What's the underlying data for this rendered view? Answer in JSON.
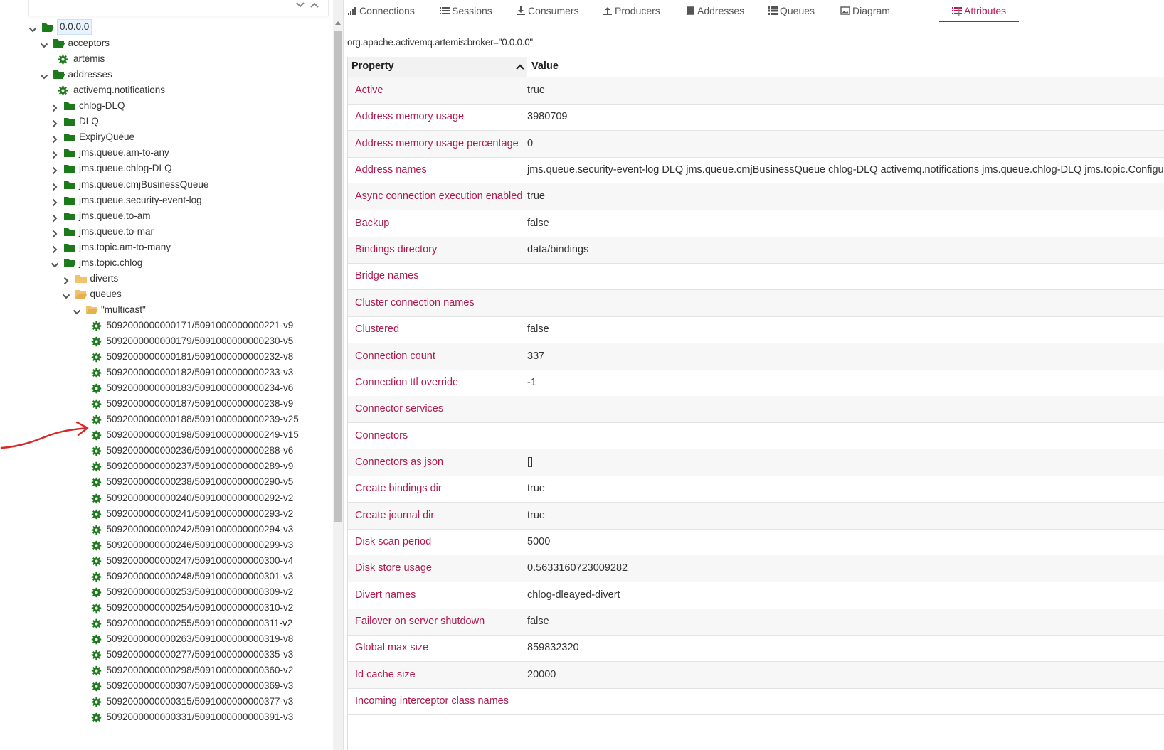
{
  "tree": {
    "nodes": [
      {
        "label": "0.0.0.0",
        "indent": 0,
        "icon": "folder-open-icon",
        "toggle": "expanded",
        "selected": true
      },
      {
        "label": "acceptors",
        "indent": 1,
        "icon": "folder-open-icon",
        "toggle": "expanded"
      },
      {
        "label": "artemis",
        "indent": 2,
        "icon": "gear-icon",
        "toggle": "none"
      },
      {
        "label": "addresses",
        "indent": 1,
        "icon": "folder-open-icon",
        "toggle": "expanded"
      },
      {
        "label": "activemq.notifications",
        "indent": 2,
        "icon": "gear-icon",
        "toggle": "none"
      },
      {
        "label": "chlog-DLQ",
        "indent": 2,
        "icon": "folder-icon",
        "toggle": "collapsed"
      },
      {
        "label": "DLQ",
        "indent": 2,
        "icon": "folder-icon",
        "toggle": "collapsed"
      },
      {
        "label": "ExpiryQueue",
        "indent": 2,
        "icon": "folder-icon",
        "toggle": "collapsed"
      },
      {
        "label": "jms.queue.am-to-any",
        "indent": 2,
        "icon": "folder-icon",
        "toggle": "collapsed"
      },
      {
        "label": "jms.queue.chlog-DLQ",
        "indent": 2,
        "icon": "folder-icon",
        "toggle": "collapsed"
      },
      {
        "label": "jms.queue.cmjBusinessQueue",
        "indent": 2,
        "icon": "folder-icon",
        "toggle": "collapsed"
      },
      {
        "label": "jms.queue.security-event-log",
        "indent": 2,
        "icon": "folder-icon",
        "toggle": "collapsed"
      },
      {
        "label": "jms.queue.to-am",
        "indent": 2,
        "icon": "folder-icon",
        "toggle": "collapsed"
      },
      {
        "label": "jms.queue.to-mar",
        "indent": 2,
        "icon": "folder-icon",
        "toggle": "collapsed"
      },
      {
        "label": "jms.topic.am-to-many",
        "indent": 2,
        "icon": "folder-icon",
        "toggle": "collapsed"
      },
      {
        "label": "jms.topic.chlog",
        "indent": 2,
        "icon": "folder-open-icon",
        "toggle": "expanded"
      },
      {
        "label": "diverts",
        "indent": 3,
        "icon": "folder-plain-icon",
        "toggle": "collapsed"
      },
      {
        "label": "queues",
        "indent": 3,
        "icon": "folder-open-plain-icon",
        "toggle": "expanded"
      },
      {
        "label": "\"multicast\"",
        "indent": 4,
        "icon": "folder-open-plain-icon",
        "toggle": "expanded"
      },
      {
        "label": "5092000000000171/5091000000000221-v9",
        "indent": 5,
        "icon": "gear-icon",
        "toggle": "none"
      },
      {
        "label": "5092000000000179/5091000000000230-v5",
        "indent": 5,
        "icon": "gear-icon",
        "toggle": "none"
      },
      {
        "label": "5092000000000181/5091000000000232-v8",
        "indent": 5,
        "icon": "gear-icon",
        "toggle": "none"
      },
      {
        "label": "5092000000000182/5091000000000233-v3",
        "indent": 5,
        "icon": "gear-icon",
        "toggle": "none"
      },
      {
        "label": "5092000000000183/5091000000000234-v6",
        "indent": 5,
        "icon": "gear-icon",
        "toggle": "none"
      },
      {
        "label": "5092000000000187/5091000000000238-v9",
        "indent": 5,
        "icon": "gear-icon",
        "toggle": "none"
      },
      {
        "label": "5092000000000188/5091000000000239-v25",
        "indent": 5,
        "icon": "gear-icon",
        "toggle": "none"
      },
      {
        "label": "5092000000000198/5091000000000249-v15",
        "indent": 5,
        "icon": "gear-icon",
        "toggle": "none"
      },
      {
        "label": "5092000000000236/5091000000000288-v6",
        "indent": 5,
        "icon": "gear-icon",
        "toggle": "none"
      },
      {
        "label": "5092000000000237/5091000000000289-v9",
        "indent": 5,
        "icon": "gear-icon",
        "toggle": "none"
      },
      {
        "label": "5092000000000238/5091000000000290-v5",
        "indent": 5,
        "icon": "gear-icon",
        "toggle": "none"
      },
      {
        "label": "5092000000000240/5091000000000292-v2",
        "indent": 5,
        "icon": "gear-icon",
        "toggle": "none"
      },
      {
        "label": "5092000000000241/5091000000000293-v2",
        "indent": 5,
        "icon": "gear-icon",
        "toggle": "none"
      },
      {
        "label": "5092000000000242/5091000000000294-v3",
        "indent": 5,
        "icon": "gear-icon",
        "toggle": "none"
      },
      {
        "label": "5092000000000246/5091000000000299-v3",
        "indent": 5,
        "icon": "gear-icon",
        "toggle": "none"
      },
      {
        "label": "5092000000000247/5091000000000300-v4",
        "indent": 5,
        "icon": "gear-icon",
        "toggle": "none"
      },
      {
        "label": "5092000000000248/5091000000000301-v3",
        "indent": 5,
        "icon": "gear-icon",
        "toggle": "none"
      },
      {
        "label": "5092000000000253/5091000000000309-v2",
        "indent": 5,
        "icon": "gear-icon",
        "toggle": "none"
      },
      {
        "label": "5092000000000254/5091000000000310-v2",
        "indent": 5,
        "icon": "gear-icon",
        "toggle": "none"
      },
      {
        "label": "5092000000000255/5091000000000311-v2",
        "indent": 5,
        "icon": "gear-icon",
        "toggle": "none"
      },
      {
        "label": "5092000000000263/5091000000000319-v8",
        "indent": 5,
        "icon": "gear-icon",
        "toggle": "none"
      },
      {
        "label": "5092000000000277/5091000000000335-v3",
        "indent": 5,
        "icon": "gear-icon",
        "toggle": "none"
      },
      {
        "label": "5092000000000298/5091000000000360-v2",
        "indent": 5,
        "icon": "gear-icon",
        "toggle": "none"
      },
      {
        "label": "5092000000000307/5091000000000369-v3",
        "indent": 5,
        "icon": "gear-icon",
        "toggle": "none"
      },
      {
        "label": "5092000000000315/5091000000000377-v3",
        "indent": 5,
        "icon": "gear-icon",
        "toggle": "none"
      },
      {
        "label": "5092000000000331/5091000000000391-v3",
        "indent": 5,
        "icon": "gear-icon",
        "toggle": "none"
      }
    ]
  },
  "tabs": [
    {
      "label": "Connections",
      "icon": "signal-icon",
      "active": false
    },
    {
      "label": "Sessions",
      "icon": "list-icon",
      "active": false
    },
    {
      "label": "Consumers",
      "icon": "download-icon",
      "active": false
    },
    {
      "label": "Producers",
      "icon": "upload-icon",
      "active": false
    },
    {
      "label": "Addresses",
      "icon": "book-icon",
      "active": false
    },
    {
      "label": "Queues",
      "icon": "th-list-icon",
      "active": false
    },
    {
      "label": "Diagram",
      "icon": "picture-icon",
      "active": false
    },
    {
      "label": "Attributes",
      "icon": "list-icon",
      "active": true
    }
  ],
  "tab_separator": "|",
  "mbean_name": "org.apache.activemq.artemis:broker=\"0.0.0.0\"",
  "grid": {
    "property_header": "Property",
    "value_header": "Value",
    "sort": "ascending",
    "rows": [
      {
        "property": "Active",
        "value": "true"
      },
      {
        "property": "Address memory usage",
        "value": "3980709"
      },
      {
        "property": "Address memory usage percentage",
        "value": "0"
      },
      {
        "property": "Address names",
        "value": "jms.queue.security-event-log DLQ jms.queue.cmjBusinessQueue chlog-DLQ activemq.notifications jms.queue.chlog-DLQ jms.topic.Configurat"
      },
      {
        "property": "Async connection execution enabled",
        "value": "true"
      },
      {
        "property": "Backup",
        "value": "false"
      },
      {
        "property": "Bindings directory",
        "value": "data/bindings"
      },
      {
        "property": "Bridge names",
        "value": ""
      },
      {
        "property": "Cluster connection names",
        "value": ""
      },
      {
        "property": "Clustered",
        "value": "false"
      },
      {
        "property": "Connection count",
        "value": "337"
      },
      {
        "property": "Connection ttl override",
        "value": "-1"
      },
      {
        "property": "Connector services",
        "value": ""
      },
      {
        "property": "Connectors",
        "value": ""
      },
      {
        "property": "Connectors as json",
        "value": "[]"
      },
      {
        "property": "Create bindings dir",
        "value": "true"
      },
      {
        "property": "Create journal dir",
        "value": "true"
      },
      {
        "property": "Disk scan period",
        "value": "5000"
      },
      {
        "property": "Disk store usage",
        "value": "0.5633160723009282"
      },
      {
        "property": "Divert names",
        "value": "chlog-dleayed-divert"
      },
      {
        "property": "Failover on server shutdown",
        "value": "false"
      },
      {
        "property": "Global max size",
        "value": "859832320"
      },
      {
        "property": "Id cache size",
        "value": "20000"
      },
      {
        "property": "Incoming interceptor class names",
        "value": ""
      }
    ]
  },
  "colors": {
    "accent": "#c0134e",
    "tree_icon_green": "#1c7a1c",
    "folder_yellow": "#f0c36d",
    "annotation_red": "#d42b2b"
  }
}
